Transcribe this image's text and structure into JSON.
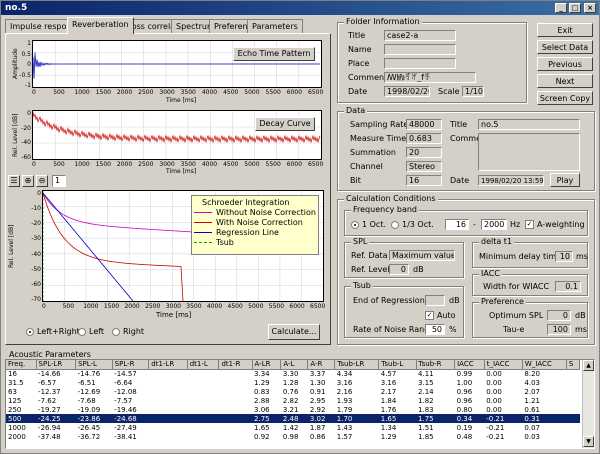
{
  "window": {
    "title": "no.5"
  },
  "tabs": [
    {
      "label": "Impulse response",
      "active": false
    },
    {
      "label": "Reverberation",
      "active": true
    },
    {
      "label": "Cross correlation",
      "active": false
    },
    {
      "label": "Spectrum",
      "active": false
    },
    {
      "label": "Preference",
      "active": false
    },
    {
      "label": "Parameters",
      "active": false
    }
  ],
  "plots": {
    "echo": {
      "button": "Echo Time Pattern",
      "ylabel": "Amplitude",
      "xlabel": "Time [ms]",
      "yticks": [
        "1",
        "0.5",
        "0",
        "-0.5",
        "-1"
      ],
      "xticks": [
        "0",
        "500",
        "1000",
        "1500",
        "2000",
        "2500",
        "3000",
        "3500",
        "4000",
        "4500",
        "5000",
        "5500",
        "6000",
        "6500"
      ]
    },
    "decay": {
      "button": "Decay Curve",
      "ylabel": "Rel. Level [dB]",
      "xlabel": "Time [ms]",
      "yticks": [
        "0",
        "-20",
        "-40",
        "-60"
      ],
      "xticks": [
        "0",
        "500",
        "1000",
        "1500",
        "2000",
        "2500",
        "3000",
        "3500",
        "4000",
        "4500",
        "5000",
        "5500",
        "6000",
        "6500"
      ]
    },
    "schroeder": {
      "ylabel": "Rel. Level [dB]",
      "xlabel": "Time [ms]",
      "yticks": [
        "0",
        "-10",
        "-20",
        "-30",
        "-40",
        "-50",
        "-60",
        "-70"
      ],
      "xticks": [
        "0",
        "500",
        "1000",
        "1500",
        "2000",
        "2500",
        "3000",
        "3500",
        "4000",
        "4500",
        "5000",
        "5500",
        "6000",
        "6500"
      ],
      "legend_title": "Schroeder Integration",
      "legend": [
        "Without Noise Correction",
        "With Noise Correction",
        "Regression Line",
        "Tsub"
      ],
      "zoom_value": "1"
    }
  },
  "channel_radios": {
    "options": [
      "Left+Right",
      "Left",
      "Right"
    ],
    "selected": 0
  },
  "calculate_label": "Calculate...",
  "folder": {
    "title_label": "Folder Information",
    "fields": [
      {
        "label": "Title",
        "value": "case2-a"
      },
      {
        "label": "Name",
        "value": ""
      },
      {
        "label": "Place",
        "value": ""
      },
      {
        "label": "Comment",
        "value": "ꟿ㍱ꆔꅌ_fꆕ"
      }
    ],
    "date_label": "Date",
    "date_value": "1998/02/20",
    "scale_label": "Scale",
    "scale_value": "1/10"
  },
  "buttons": [
    "Exit",
    "Select Data",
    "Previous",
    "Next",
    "Screen Copy"
  ],
  "data": {
    "title_label": "Data",
    "sampling_rate_label": "Sampling Rate",
    "sampling_rate": "48000",
    "measure_time_label": "Measure Time",
    "measure_time": "0.683",
    "summation_label": "Summation",
    "summation": "20",
    "channel_label": "Channel",
    "channel": "Stereo",
    "bit_label": "Bit",
    "bit": "16",
    "title2_label": "Title",
    "title2": "no.5",
    "comment_label": "Comment",
    "date_label": "Date",
    "date": "1998/02/20 13:59:08",
    "play_label": "Play"
  },
  "calc": {
    "title_label": "Calculation Conditions",
    "freq_band_label": "Frequency band",
    "band_1oct": "1 Oct.",
    "band_13oct": "1/3 Oct.",
    "freq_from": "16",
    "freq_to": "2000",
    "hz": "Hz",
    "dash": "-",
    "aweight_label": "A-weighting",
    "spl_label": "SPL",
    "ref_data_label": "Ref. Data",
    "ref_data": "Maximum value",
    "ref_level_label": "Ref. Level",
    "ref_level": "0",
    "db": "dB",
    "deltat1_label": "delta t1",
    "min_delay_label": "Minimum delay time",
    "min_delay": "10",
    "ms": "ms",
    "iacc_label": "IACC",
    "width_label": "Width for WIACC",
    "width": "0.1",
    "tsub_label": "Tsub",
    "end_reg_label": "End of Regression",
    "end_reg": "",
    "auto_label": "Auto",
    "rate_label": "Rate of Noise Range",
    "rate": "50",
    "percent": "%",
    "pref_label": "Preference",
    "opt_spl_label": "Optimum SPL",
    "opt_spl": "0",
    "taue_label": "Tau-e",
    "taue": "100"
  },
  "acoustic": {
    "title_label": "Acoustic Parameters",
    "headers": [
      "Freq.",
      "SPL-LR",
      "SPL-L",
      "SPL-R",
      "dt1-LR",
      "dt1-L",
      "dt1-R",
      "A-LR",
      "A-L",
      "A-R",
      "Tsub-LR",
      "Tsub-L",
      "Tsub-R",
      "IACC",
      "t_IACC",
      "W_IACC",
      "S"
    ],
    "rows": [
      [
        "16",
        "-14.66",
        "-14.76",
        "-14.57",
        "",
        "",
        "",
        "3.34",
        "3.30",
        "3.37",
        "4.34",
        "4.57",
        "4.11",
        "0.99",
        "0.00",
        "8.20",
        ""
      ],
      [
        "31.5",
        "-6.57",
        "-6.51",
        "-6.64",
        "",
        "",
        "",
        "1.29",
        "1.28",
        "1.30",
        "3.16",
        "3.16",
        "3.15",
        "1.00",
        "0.00",
        "4.03",
        ""
      ],
      [
        "63",
        "-12.37",
        "-12.69",
        "-12.08",
        "",
        "",
        "",
        "0.83",
        "0.76",
        "0.91",
        "2.16",
        "2.17",
        "2.14",
        "0.96",
        "0.00",
        "2.07",
        ""
      ],
      [
        "125",
        "-7.62",
        "-7.68",
        "-7.57",
        "",
        "",
        "",
        "2.88",
        "2.82",
        "2.95",
        "1.93",
        "1.84",
        "1.82",
        "0.96",
        "0.00",
        "1.21",
        ""
      ],
      [
        "250",
        "-19.27",
        "-19.09",
        "-19.46",
        "",
        "",
        "",
        "3.06",
        "3.21",
        "2.92",
        "1.79",
        "1.76",
        "1.83",
        "0.80",
        "0.00",
        "0.61",
        ""
      ],
      [
        "500",
        "-24.25",
        "-23.86",
        "-24.68",
        "",
        "",
        "",
        "2.75",
        "2.48",
        "3.02",
        "1.70",
        "1.65",
        "1.75",
        "0.34",
        "-0.21",
        "0.31",
        ""
      ],
      [
        "1000",
        "-26.94",
        "-26.45",
        "-27.49",
        "",
        "",
        "",
        "1.65",
        "1.42",
        "1.87",
        "1.43",
        "1.34",
        "1.51",
        "0.19",
        "-0.21",
        "0.07",
        ""
      ],
      [
        "2000",
        "-37.48",
        "-36.72",
        "-38.41",
        "",
        "",
        "",
        "0.92",
        "0.98",
        "0.86",
        "1.57",
        "1.29",
        "1.85",
        "0.48",
        "-0.21",
        "0.03",
        ""
      ]
    ],
    "selected_row": 5
  }
}
